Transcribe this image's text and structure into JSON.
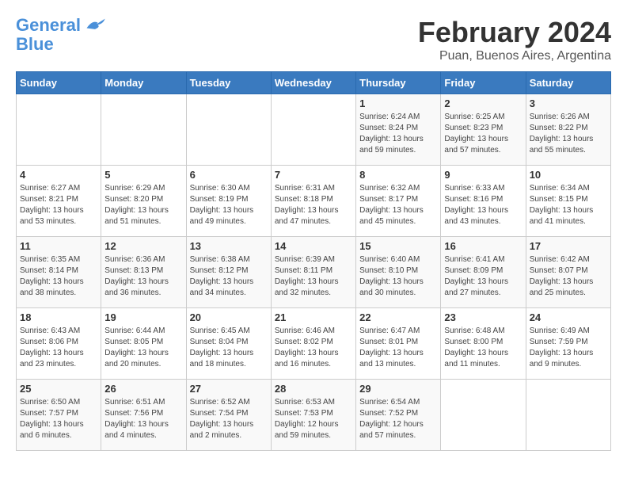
{
  "logo": {
    "line1": "General",
    "line2": "Blue"
  },
  "title": "February 2024",
  "subtitle": "Puan, Buenos Aires, Argentina",
  "days_of_week": [
    "Sunday",
    "Monday",
    "Tuesday",
    "Wednesday",
    "Thursday",
    "Friday",
    "Saturday"
  ],
  "weeks": [
    [
      {
        "day": "",
        "info": ""
      },
      {
        "day": "",
        "info": ""
      },
      {
        "day": "",
        "info": ""
      },
      {
        "day": "",
        "info": ""
      },
      {
        "day": "1",
        "info": "Sunrise: 6:24 AM\nSunset: 8:24 PM\nDaylight: 13 hours\nand 59 minutes."
      },
      {
        "day": "2",
        "info": "Sunrise: 6:25 AM\nSunset: 8:23 PM\nDaylight: 13 hours\nand 57 minutes."
      },
      {
        "day": "3",
        "info": "Sunrise: 6:26 AM\nSunset: 8:22 PM\nDaylight: 13 hours\nand 55 minutes."
      }
    ],
    [
      {
        "day": "4",
        "info": "Sunrise: 6:27 AM\nSunset: 8:21 PM\nDaylight: 13 hours\nand 53 minutes."
      },
      {
        "day": "5",
        "info": "Sunrise: 6:29 AM\nSunset: 8:20 PM\nDaylight: 13 hours\nand 51 minutes."
      },
      {
        "day": "6",
        "info": "Sunrise: 6:30 AM\nSunset: 8:19 PM\nDaylight: 13 hours\nand 49 minutes."
      },
      {
        "day": "7",
        "info": "Sunrise: 6:31 AM\nSunset: 8:18 PM\nDaylight: 13 hours\nand 47 minutes."
      },
      {
        "day": "8",
        "info": "Sunrise: 6:32 AM\nSunset: 8:17 PM\nDaylight: 13 hours\nand 45 minutes."
      },
      {
        "day": "9",
        "info": "Sunrise: 6:33 AM\nSunset: 8:16 PM\nDaylight: 13 hours\nand 43 minutes."
      },
      {
        "day": "10",
        "info": "Sunrise: 6:34 AM\nSunset: 8:15 PM\nDaylight: 13 hours\nand 41 minutes."
      }
    ],
    [
      {
        "day": "11",
        "info": "Sunrise: 6:35 AM\nSunset: 8:14 PM\nDaylight: 13 hours\nand 38 minutes."
      },
      {
        "day": "12",
        "info": "Sunrise: 6:36 AM\nSunset: 8:13 PM\nDaylight: 13 hours\nand 36 minutes."
      },
      {
        "day": "13",
        "info": "Sunrise: 6:38 AM\nSunset: 8:12 PM\nDaylight: 13 hours\nand 34 minutes."
      },
      {
        "day": "14",
        "info": "Sunrise: 6:39 AM\nSunset: 8:11 PM\nDaylight: 13 hours\nand 32 minutes."
      },
      {
        "day": "15",
        "info": "Sunrise: 6:40 AM\nSunset: 8:10 PM\nDaylight: 13 hours\nand 30 minutes."
      },
      {
        "day": "16",
        "info": "Sunrise: 6:41 AM\nSunset: 8:09 PM\nDaylight: 13 hours\nand 27 minutes."
      },
      {
        "day": "17",
        "info": "Sunrise: 6:42 AM\nSunset: 8:07 PM\nDaylight: 13 hours\nand 25 minutes."
      }
    ],
    [
      {
        "day": "18",
        "info": "Sunrise: 6:43 AM\nSunset: 8:06 PM\nDaylight: 13 hours\nand 23 minutes."
      },
      {
        "day": "19",
        "info": "Sunrise: 6:44 AM\nSunset: 8:05 PM\nDaylight: 13 hours\nand 20 minutes."
      },
      {
        "day": "20",
        "info": "Sunrise: 6:45 AM\nSunset: 8:04 PM\nDaylight: 13 hours\nand 18 minutes."
      },
      {
        "day": "21",
        "info": "Sunrise: 6:46 AM\nSunset: 8:02 PM\nDaylight: 13 hours\nand 16 minutes."
      },
      {
        "day": "22",
        "info": "Sunrise: 6:47 AM\nSunset: 8:01 PM\nDaylight: 13 hours\nand 13 minutes."
      },
      {
        "day": "23",
        "info": "Sunrise: 6:48 AM\nSunset: 8:00 PM\nDaylight: 13 hours\nand 11 minutes."
      },
      {
        "day": "24",
        "info": "Sunrise: 6:49 AM\nSunset: 7:59 PM\nDaylight: 13 hours\nand 9 minutes."
      }
    ],
    [
      {
        "day": "25",
        "info": "Sunrise: 6:50 AM\nSunset: 7:57 PM\nDaylight: 13 hours\nand 6 minutes."
      },
      {
        "day": "26",
        "info": "Sunrise: 6:51 AM\nSunset: 7:56 PM\nDaylight: 13 hours\nand 4 minutes."
      },
      {
        "day": "27",
        "info": "Sunrise: 6:52 AM\nSunset: 7:54 PM\nDaylight: 13 hours\nand 2 minutes."
      },
      {
        "day": "28",
        "info": "Sunrise: 6:53 AM\nSunset: 7:53 PM\nDaylight: 12 hours\nand 59 minutes."
      },
      {
        "day": "29",
        "info": "Sunrise: 6:54 AM\nSunset: 7:52 PM\nDaylight: 12 hours\nand 57 minutes."
      },
      {
        "day": "",
        "info": ""
      },
      {
        "day": "",
        "info": ""
      }
    ]
  ]
}
